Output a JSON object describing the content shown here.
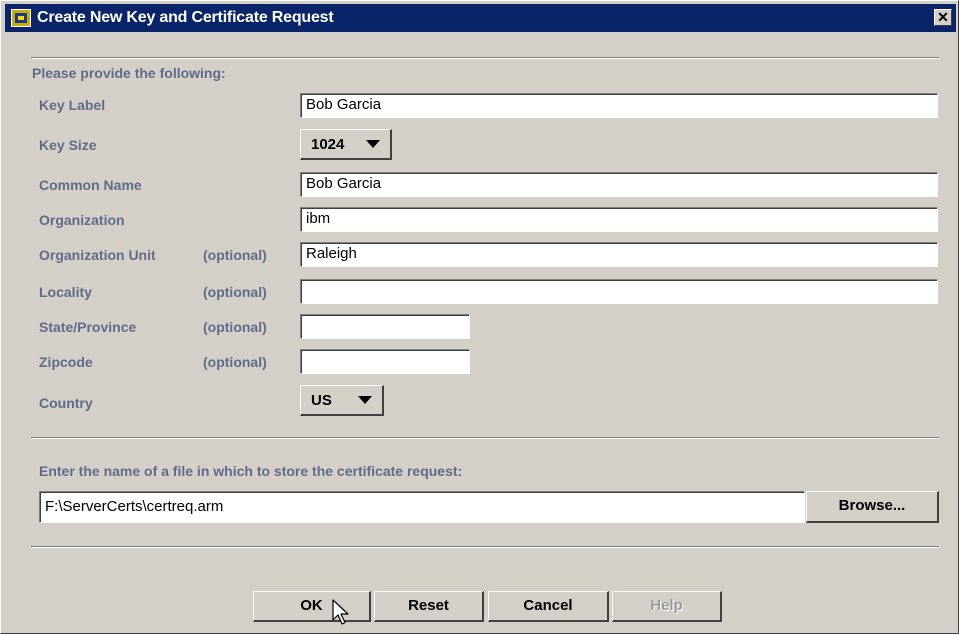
{
  "window": {
    "title": "Create New Key and Certificate Request",
    "close_label": "✕"
  },
  "form": {
    "heading": "Please provide the following:",
    "optional_tag": "(optional)",
    "key_label": {
      "label": "Key Label",
      "value": "Bob Garcia"
    },
    "key_size": {
      "label": "Key Size",
      "value": "1024"
    },
    "common_name": {
      "label": "Common Name",
      "value": "Bob Garcia"
    },
    "organization": {
      "label": "Organization",
      "value": "ibm"
    },
    "org_unit": {
      "label": "Organization Unit",
      "value": "Raleigh"
    },
    "locality": {
      "label": "Locality",
      "value": ""
    },
    "state": {
      "label": "State/Province",
      "value": ""
    },
    "zipcode": {
      "label": "Zipcode",
      "value": ""
    },
    "country": {
      "label": "Country",
      "value": "US"
    }
  },
  "file": {
    "prompt": "Enter the name of a file in which to store the certificate request:",
    "path": "F:\\ServerCerts\\certreq.arm",
    "browse_label": "Browse..."
  },
  "buttons": {
    "ok": "OK",
    "reset": "Reset",
    "cancel": "Cancel",
    "help": "Help"
  },
  "colors": {
    "title_bar": "#0a246a",
    "label_text": "#5f6b8a",
    "face": "#d4d0c8"
  }
}
